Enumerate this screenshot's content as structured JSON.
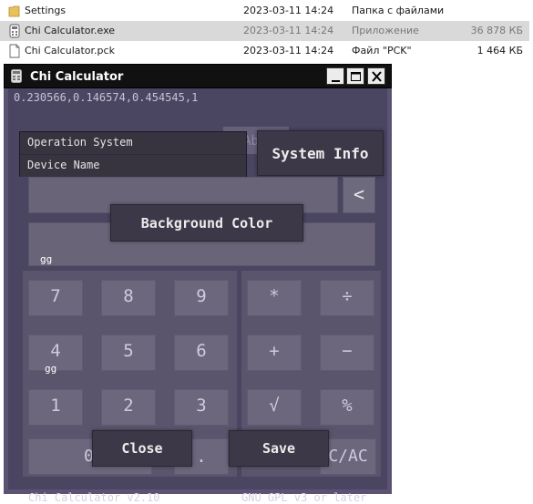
{
  "explorer": {
    "rows": [
      {
        "name": "Settings",
        "date": "2023-03-11 14:24",
        "type": "Папка с файлами",
        "size": "",
        "icon": "folder-icon"
      },
      {
        "name": "Chi Calculator.exe",
        "date": "2023-03-11 14:24",
        "type": "Приложение",
        "size": "36 878 КБ",
        "icon": "exe-file-icon"
      },
      {
        "name": "Chi Calculator.pck",
        "date": "2023-03-11 14:24",
        "type": "Файл \"PCK\"",
        "size": "1 464 КБ",
        "icon": "file-icon"
      }
    ],
    "selected_index": 1
  },
  "window": {
    "title": "Chi Calculator",
    "icons": {
      "app": "calculator-app-icon",
      "minimize": "minimize-icon",
      "maximize": "maximize-icon",
      "close": "close-icon"
    }
  },
  "calculator": {
    "top_line": "0.230566,0.146574,0.454545,1",
    "ghost_button": "Ab",
    "dropdown": [
      "Operation System",
      "Device Name"
    ],
    "system_info": "System Info",
    "background_color": "Background Color",
    "backspace": "<",
    "gg_labels": [
      "gg",
      "gg"
    ],
    "keys": {
      "k7": "7",
      "k8": "8",
      "k9": "9",
      "k4": "4",
      "k5": "5",
      "k6": "6",
      "k1": "1",
      "k2": "2",
      "k3": "3",
      "k0": "0",
      "dot": ".",
      "mul": "*",
      "div": "÷",
      "plus": "+",
      "minus": "−",
      "sqrt": "√",
      "pct": "%",
      "cac": "C/AC"
    },
    "close": "Close",
    "save": "Save",
    "footer_left": "Chi Calculator v2.10",
    "footer_right": "GNU GPL v3 or later"
  },
  "colors": {
    "accent": "#5c5373",
    "panel": "#4a4561",
    "button_dark": "#3c3848",
    "key": "#6c677c"
  }
}
